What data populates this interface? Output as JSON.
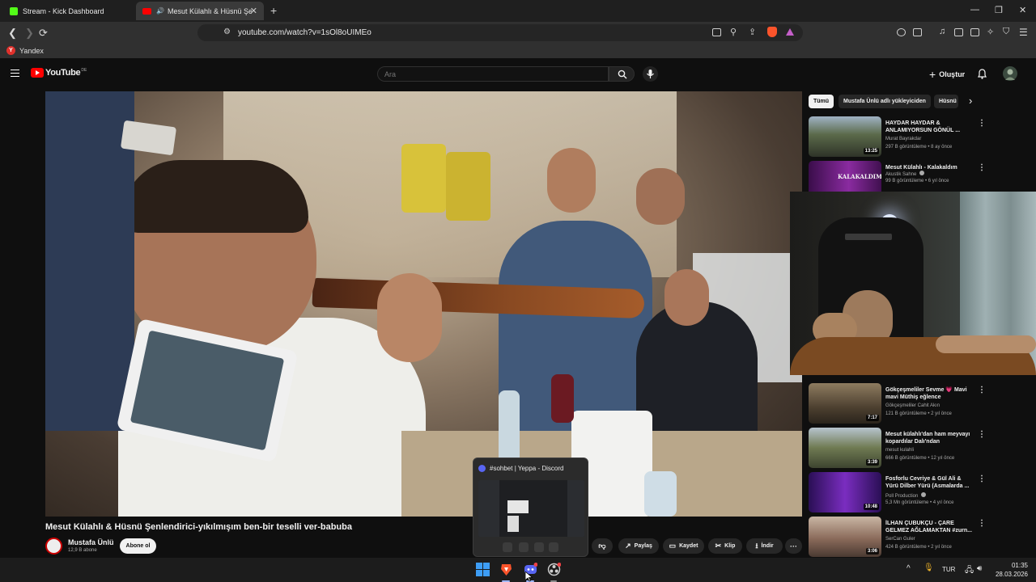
{
  "browser": {
    "tabs": [
      {
        "title": "Stream - Kick Dashboard",
        "favicon_color": "#53fc18",
        "active": false
      },
      {
        "title": "Mesut Külahlı & Hüsnü Şenlendirici",
        "favicon_color": "#ff0000",
        "active": true
      }
    ],
    "new_tab_label": "+",
    "window_controls": {
      "minimize": "—",
      "maximize": "❐",
      "close": "✕"
    },
    "url": "youtube.com/watch?v=1sOl8oUIMEo",
    "bookmarks": [
      {
        "label": "Yandex",
        "icon": "Y"
      }
    ]
  },
  "youtube": {
    "logo_text": "YouTube",
    "logo_country": "DE",
    "search_placeholder": "Ara",
    "create_label": "Oluştur",
    "create_icon": "+",
    "video": {
      "title": "Mesut Külahlı & Hüsnü Şenlendirici-yıkılmışım ben-bir teselli ver-babuba",
      "channel": "Mustafa Ünlü",
      "subscribers": "12,9 B abone",
      "subscribe_label": "Abone ol",
      "actions": [
        {
          "label": "Paylaş",
          "icon": "share-icon",
          "glyph": "↗"
        },
        {
          "label": "Kaydet",
          "icon": "bookmark-icon",
          "glyph": "▭"
        },
        {
          "label": "Klip",
          "icon": "scissors-icon",
          "glyph": "✂"
        },
        {
          "label": "İndir",
          "icon": "download-icon",
          "glyph": "⭳"
        }
      ],
      "more_glyph": "···"
    },
    "chips": [
      "Tümü",
      "Mustafa Ünlü adlı yükleyiciden",
      "Hüsnü"
    ],
    "chips_next": "›",
    "recommendations": [
      {
        "title": "HAYDAR HAYDAR & ANLAMIYORSUN GÖNÜL ...",
        "channel": "Murat Bayrakdar",
        "meta": "297 B görüntüleme • 8 ay önce",
        "duration": "13:25",
        "thumb_color": "#5b6a4a",
        "verified": false
      },
      {
        "title": "Mesut Külahlı - Kalakaldım",
        "channel": "Akustik Sahne",
        "meta": "99 B görüntüleme • 6 yıl önce",
        "duration": "",
        "thumb_color": "#6a1a6e",
        "thumb_text": "KALAKALDIM",
        "verified": true
      },
      {
        "title": "Gökçeşmeliler Sevme 💗 Mavi mavi Müthiş eğlence",
        "channel": "Gökçeşmeliler Cahit Akın",
        "meta": "121 B görüntüleme • 2 yıl önce",
        "duration": "7:17",
        "thumb_color": "#6b5a3f",
        "verified": false
      },
      {
        "title": "Mesut külahlı'dan ham meyvayı kopardılar Dalı'ndan",
        "channel": "mesut kulahli",
        "meta": "666 B görüntüleme • 12 yıl önce",
        "duration": "3:39",
        "thumb_color": "#6f7a52",
        "verified": false
      },
      {
        "title": "Fosforlu Cevriye & Gül Ali & Yürü Dilber Yürü (Asmalarda ...",
        "channel": "Poll Production",
        "meta": "5,3 Mn görüntüleme • 4 yıl önce",
        "duration": "10:48",
        "thumb_color": "#5a2a8a",
        "verified": true
      },
      {
        "title": "İLHAN ÇUBUKÇU - ÇARE GELMEZ AĞLAMAKTAN #zurn...",
        "channel": "SerCan Guler",
        "meta": "424 B görüntüleme • 2 yıl önce",
        "duration": "3:06",
        "thumb_color": "#8a6a5a",
        "verified": false
      }
    ]
  },
  "discord_popup": {
    "title": "#sohbet | Yeppa - Discord"
  },
  "taskbar": {
    "language": "TUR",
    "time": "01:35",
    "date": "28.03.2026",
    "chevron": "^"
  }
}
